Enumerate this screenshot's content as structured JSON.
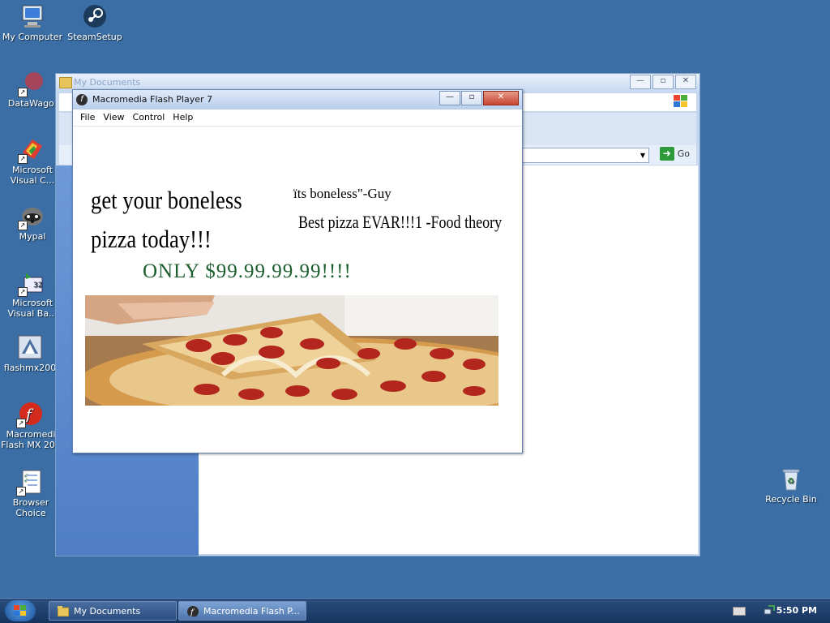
{
  "desktop": {
    "icons": [
      {
        "label": "My Computer",
        "icon": "computer-icon"
      },
      {
        "label": "SteamSetup",
        "icon": "steam-icon"
      },
      {
        "label": "DataWago.",
        "icon": "datawagon-icon"
      },
      {
        "label": "Microsoft Visual C...",
        "icon": "visual-c-icon"
      },
      {
        "label": "Mypal",
        "icon": "mypal-icon"
      },
      {
        "label": "Microsoft Visual Ba...",
        "icon": "visual-basic-icon"
      },
      {
        "label": "flashmx200",
        "icon": "flashmx-icon"
      },
      {
        "label": "Macromedi Flash MX 200",
        "icon": "flash-mx-icon"
      },
      {
        "label": "Browser Choice",
        "icon": "browser-choice-icon"
      },
      {
        "label": "Recycle Bin",
        "icon": "recycle-bin-icon"
      }
    ]
  },
  "explorer": {
    "title": "My Documents",
    "go_label": "Go"
  },
  "flash": {
    "title": "Macromedia Flash Player 7",
    "menu": [
      "File",
      "View",
      "Control",
      "Help"
    ],
    "headline_line1": "get your boneless",
    "headline_line2": "pizza today!!!",
    "quote1": "ïts boneless\"-Guy",
    "quote2": "Best pizza EVAR!!!1 -Food theory",
    "price": "ONLY $99.99.99.99!!!!",
    "image": "pepperoni-pizza-image"
  },
  "taskbar": {
    "buttons": [
      "My Documents",
      "Macromedia Flash P..."
    ],
    "clock": "5:50 PM"
  },
  "colors": {
    "desktop": "#3a6ea5",
    "price_text": "#1c5e2e",
    "close_button": "#c74532"
  }
}
